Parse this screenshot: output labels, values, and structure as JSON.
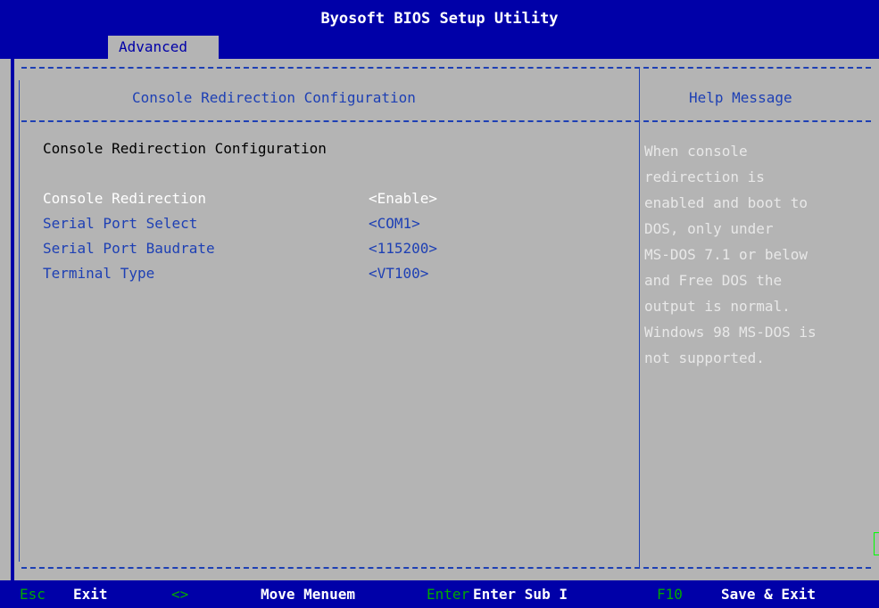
{
  "window": {
    "title": "Byosoft BIOS Setup Utility"
  },
  "tabs": [
    {
      "label": "Advanced"
    }
  ],
  "header": {
    "title": "Console Redirection Configuration",
    "help_title": "Help Message"
  },
  "section_title": "Console Redirection Configuration",
  "settings": [
    {
      "label": "Console Redirection",
      "value": "<Enable>"
    },
    {
      "label": "Serial Port Select",
      "value": "<COM1>"
    },
    {
      "label": "Serial Port Baudrate",
      "value": "<115200>"
    },
    {
      "label": "Terminal Type",
      "value": "<VT100>"
    }
  ],
  "help_text": "When console\nredirection is\nenabled and boot to\nDOS, only under\nMS-DOS 7.1 or below\nand Free DOS the\noutput is normal.\nWindows 98 MS-DOS is\nnot supported.",
  "footer": {
    "esc_key": "Esc",
    "esc_action": "Exit",
    "arrows_key": "<>",
    "arrows_action": "Move Menuem",
    "enter_key": "Enter",
    "enter_action": "Enter Sub I",
    "f10_key": "F10",
    "f10_action": "Save & Exit"
  },
  "colors": {
    "bar": "#0000a8",
    "background": "#b4b4b4",
    "text_blue": "#1e40b4",
    "highlight": "#ffffff",
    "key_green": "#00a800"
  }
}
